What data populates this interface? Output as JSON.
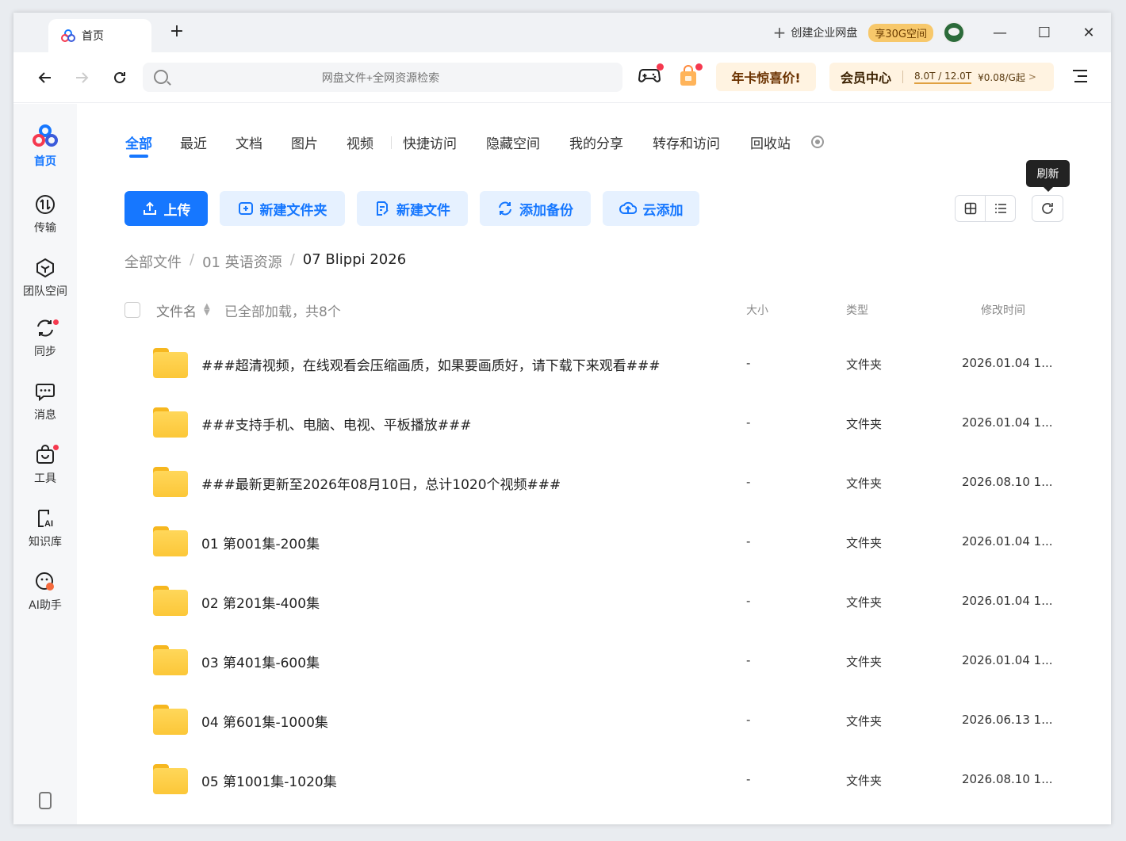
{
  "titlebar": {
    "tab_title": "首页",
    "new_tab": "+",
    "create_enterprise": "创建企业网盘",
    "storage_badge": "享30G空间",
    "minimize": "—",
    "maximize": "☐",
    "close": "✕"
  },
  "toolbar": {
    "search_placeholder": "网盘文件+全网资源检索",
    "promo": "年卡惊喜价!",
    "vip_label": "会员中心",
    "vip_quota": "8.0T / 12.0T",
    "vip_price": "¥0.08/G起"
  },
  "sidebar": {
    "items": [
      {
        "label": "首页",
        "icon": "home-logo-icon"
      },
      {
        "label": "传输",
        "icon": "transfer-icon"
      },
      {
        "label": "团队空间",
        "icon": "team-space-icon"
      },
      {
        "label": "同步",
        "icon": "sync-icon"
      },
      {
        "label": "消息",
        "icon": "message-icon"
      },
      {
        "label": "工具",
        "icon": "tools-icon"
      },
      {
        "label": "知识库",
        "icon": "knowledge-base-icon"
      },
      {
        "label": "AI助手",
        "icon": "ai-assistant-icon"
      }
    ]
  },
  "categories": [
    "全部",
    "最近",
    "文档",
    "图片",
    "视频",
    "快捷访问",
    "隐藏空间",
    "我的分享",
    "转存和访问",
    "回收站"
  ],
  "actions": {
    "upload": "上传",
    "new_folder": "新建文件夹",
    "new_file": "新建文件",
    "add_backup": "添加备份",
    "cloud_add": "云添加",
    "refresh_tooltip": "刷新"
  },
  "breadcrumb": [
    "全部文件",
    "01 英语资源",
    "07 Blippi 2026"
  ],
  "list": {
    "col_name": "文件名",
    "loaded_status": "已全部加载，共8个",
    "col_size": "大小",
    "col_type": "类型",
    "col_time": "修改时间",
    "rows": [
      {
        "name": "###超清视频，在线观看会压缩画质，如果要画质好，请下载下来观看###",
        "size": "-",
        "type": "文件夹",
        "time": "2026.01.04 1..."
      },
      {
        "name": "###支持手机、电脑、电视、平板播放###",
        "size": "-",
        "type": "文件夹",
        "time": "2026.01.04 1..."
      },
      {
        "name": "###最新更新至2026年08月10日，总计1020个视频###",
        "size": "-",
        "type": "文件夹",
        "time": "2026.08.10 1..."
      },
      {
        "name": "01 第001集-200集",
        "size": "-",
        "type": "文件夹",
        "time": "2026.01.04 1..."
      },
      {
        "name": "02 第201集-400集",
        "size": "-",
        "type": "文件夹",
        "time": "2026.01.04 1..."
      },
      {
        "name": "03 第401集-600集",
        "size": "-",
        "type": "文件夹",
        "time": "2026.01.04 1..."
      },
      {
        "name": "04 第601集-1000集",
        "size": "-",
        "type": "文件夹",
        "time": "2026.06.13 1..."
      },
      {
        "name": "05 第1001集-1020集",
        "size": "-",
        "type": "文件夹",
        "time": "2026.08.10 1..."
      }
    ]
  },
  "colors": {
    "accent": "#1677ff",
    "folder": "#fcc738",
    "notification_dot": "#f5394f",
    "promo_bg": "#fff3e1"
  }
}
